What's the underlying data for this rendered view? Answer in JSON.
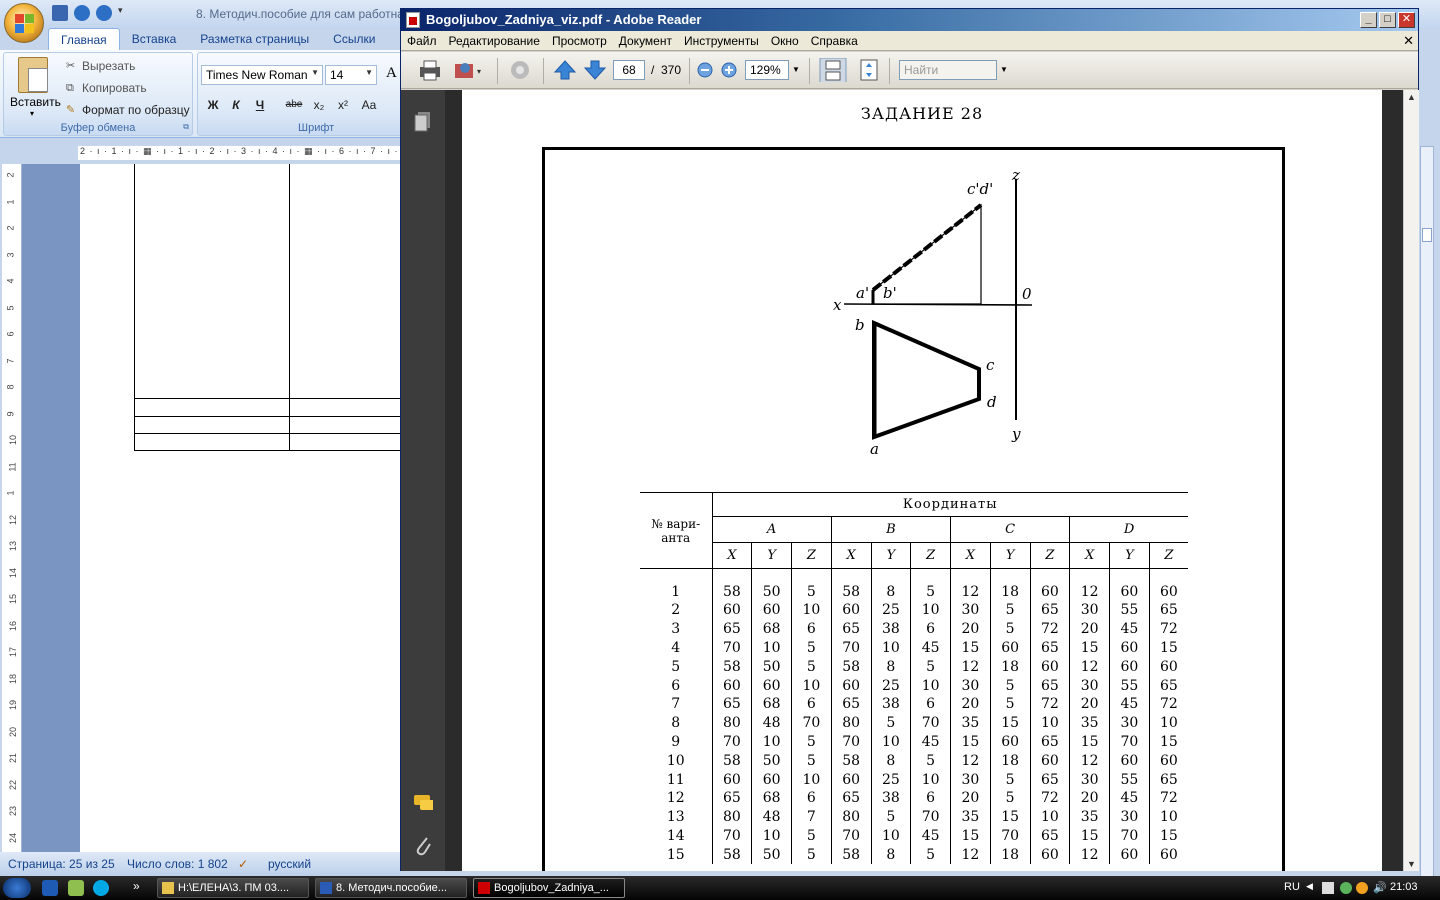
{
  "word": {
    "title": "8. Методич.пособие для сам работна",
    "tabs": [
      "Главная",
      "Вставка",
      "Разметка страницы",
      "Ссылки"
    ],
    "clipboard": {
      "paste_label": "Вставить",
      "cut_label": "Вырезать",
      "copy_label": "Копировать",
      "format_painter_label": "Формат по образцу",
      "group_label": "Буфер обмена"
    },
    "font": {
      "name": "Times New Roman",
      "size": "14",
      "grow": "A",
      "group_label": "Шрифт",
      "bold": "Ж",
      "italic": "К",
      "underline": "Ч",
      "strike": "abe",
      "subscript": "x₂",
      "superscript": "x²",
      "case": "Aa"
    },
    "ruler_h": "2 · ı · 1 · ı · ▦ · ı · 1 · ı · 2 · ı · 3 · ı · 4 · ı · ▦ · ı · 6 · ı · 7 · ı · 8 ·",
    "ruler_v": [
      "2",
      "1",
      "2",
      "3",
      "4",
      "5",
      "6",
      "7",
      "8",
      "9",
      "10",
      "11",
      "1",
      "12",
      "13",
      "14",
      "15",
      "16",
      "17",
      "18",
      "19",
      "20",
      "21",
      "22",
      "23",
      "24"
    ],
    "status": {
      "page": "Страница: 25 из 25",
      "words": "Число слов: 1 802",
      "language": "русский"
    }
  },
  "reader": {
    "title": "Bogoljubov_Zadniya_viz.pdf - Adobe Reader",
    "menu": [
      "Файл",
      "Редактирование",
      "Просмотр",
      "Документ",
      "Инструменты",
      "Окно",
      "Справка"
    ],
    "page_current": "68",
    "page_sep": "/",
    "page_total": "370",
    "zoom": "129%",
    "search_placeholder": "Найти",
    "close_doc": "✕"
  },
  "pdf": {
    "task_title": "ЗАДАНИЕ 28",
    "drawing_labels": {
      "cd_prime": "c'd'",
      "z": "z",
      "a_prime": "a'",
      "b_prime": "b'",
      "x": "x",
      "o": "0",
      "b": "b",
      "c": "c",
      "d": "d",
      "y": "y",
      "a": "a"
    },
    "table": {
      "variant_header": "№ вари-анта",
      "coords_header": "Координаты",
      "points": [
        "A",
        "B",
        "C",
        "D"
      ],
      "axes": [
        "X",
        "Y",
        "Z"
      ],
      "rows": [
        [
          "1",
          "58",
          "50",
          "5",
          "58",
          "8",
          "5",
          "12",
          "18",
          "60",
          "12",
          "60",
          "60"
        ],
        [
          "2",
          "60",
          "60",
          "10",
          "60",
          "25",
          "10",
          "30",
          "5",
          "65",
          "30",
          "55",
          "65"
        ],
        [
          "3",
          "65",
          "68",
          "6",
          "65",
          "38",
          "6",
          "20",
          "5",
          "72",
          "20",
          "45",
          "72"
        ],
        [
          "4",
          "70",
          "10",
          "5",
          "70",
          "10",
          "45",
          "15",
          "60",
          "65",
          "15",
          "60",
          "15"
        ],
        [
          "5",
          "58",
          "50",
          "5",
          "58",
          "8",
          "5",
          "12",
          "18",
          "60",
          "12",
          "60",
          "60"
        ],
        [
          "6",
          "60",
          "60",
          "10",
          "60",
          "25",
          "10",
          "30",
          "5",
          "65",
          "30",
          "55",
          "65"
        ],
        [
          "7",
          "65",
          "68",
          "6",
          "65",
          "38",
          "6",
          "20",
          "5",
          "72",
          "20",
          "45",
          "72"
        ],
        [
          "8",
          "80",
          "48",
          "70",
          "80",
          "5",
          "70",
          "35",
          "15",
          "10",
          "35",
          "30",
          "10"
        ],
        [
          "9",
          "70",
          "10",
          "5",
          "70",
          "10",
          "45",
          "15",
          "60",
          "65",
          "15",
          "70",
          "15"
        ],
        [
          "10",
          "58",
          "50",
          "5",
          "58",
          "8",
          "5",
          "12",
          "18",
          "60",
          "12",
          "60",
          "60"
        ],
        [
          "11",
          "60",
          "60",
          "10",
          "60",
          "25",
          "10",
          "30",
          "5",
          "65",
          "30",
          "55",
          "65"
        ],
        [
          "12",
          "65",
          "68",
          "6",
          "65",
          "38",
          "6",
          "20",
          "5",
          "72",
          "20",
          "45",
          "72"
        ],
        [
          "13",
          "80",
          "48",
          "7",
          "80",
          "5",
          "70",
          "35",
          "15",
          "10",
          "35",
          "30",
          "10"
        ],
        [
          "14",
          "70",
          "10",
          "5",
          "70",
          "10",
          "45",
          "15",
          "70",
          "65",
          "15",
          "70",
          "15"
        ],
        [
          "15",
          "58",
          "50",
          "5",
          "58",
          "8",
          "5",
          "12",
          "18",
          "60",
          "12",
          "60",
          "60"
        ]
      ]
    }
  },
  "taskbar": {
    "tasks": [
      "H:\\ЕЛЕНА\\3. ПМ 03....",
      "8. Методич.пособие...",
      "Bogoljubov_Zadniya_..."
    ],
    "lang": "RU",
    "time": "21:03",
    "chevron": "»"
  }
}
